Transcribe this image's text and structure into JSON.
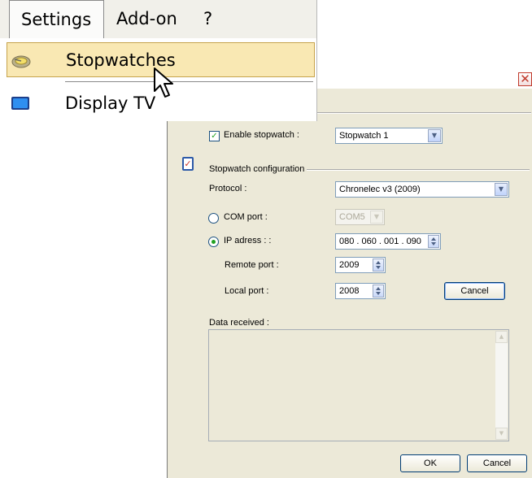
{
  "menu": {
    "bar": [
      "Settings",
      "Add-on",
      "?"
    ],
    "items": [
      {
        "label": "Stopwatches",
        "icon": "stopwatch-icon"
      },
      {
        "label": "Display TV",
        "icon": "monitor-icon"
      }
    ]
  },
  "dialog": {
    "close_glyph": "✕",
    "enable_label": "Enable stopwatch :",
    "enable_checked": true,
    "stopwatch_value": "Stopwatch 1",
    "config_title": "Stopwatch configuration",
    "protocol_label": "Protocol :",
    "protocol_value": "Chronelec v3 (2009)",
    "com_label": "COM port :",
    "com_value": "COM5",
    "ip_label": "IP adress : :",
    "ip_value": "080 . 060 . 001 . 090",
    "remote_label": "Remote port :",
    "remote_value": "2009",
    "local_label": "Local port :",
    "local_value": "2008",
    "cancel_inner": "Cancel",
    "data_label": "Data received :",
    "ok": "OK",
    "cancel": "Cancel"
  },
  "colors": {
    "accent_green": "#21a121",
    "highlight": "#f9e8b3",
    "close_red": "#c0392b"
  }
}
